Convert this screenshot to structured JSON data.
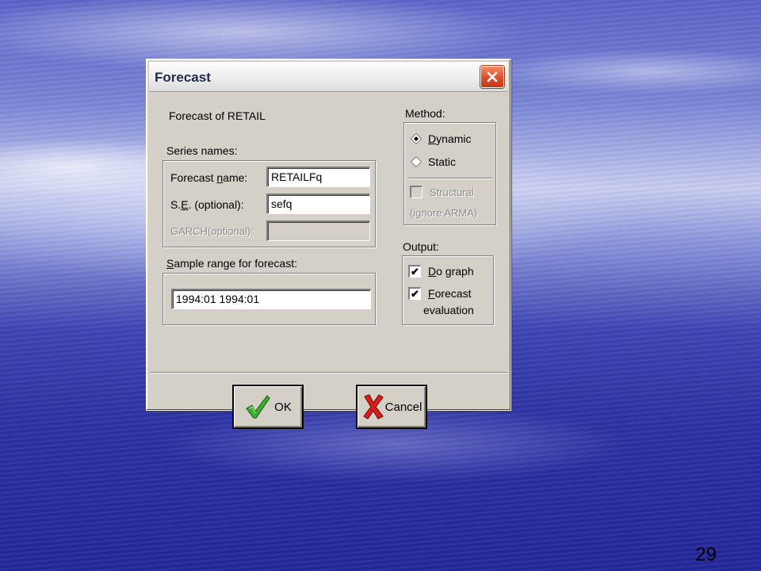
{
  "window": {
    "title": "Forecast"
  },
  "forecast_of": "Forecast of RETAIL",
  "series": {
    "label": "Series names:",
    "forecast_name": {
      "label_pre": "Forecast ",
      "label_key": "n",
      "label_post": "ame:",
      "value": "RETAILFq"
    },
    "se": {
      "label_pre": "S.",
      "label_key": "E",
      "label_post": ". (optional):",
      "value": "sefq"
    },
    "garch": {
      "label": "GARCH(optional):",
      "value": ""
    }
  },
  "sample": {
    "label_key": "S",
    "label_post": "ample range for forecast:",
    "value": "1994:01 1994:01"
  },
  "method": {
    "label": "Method:",
    "options": [
      {
        "key": "D",
        "rest": "ynamic",
        "selected": true
      },
      {
        "key": "",
        "rest": "Static",
        "selected": false
      }
    ],
    "structural": {
      "label": "Structural",
      "note": "(ignore ARMA)"
    }
  },
  "output": {
    "label": "Output:",
    "do_graph": {
      "key": "D",
      "rest": "o graph",
      "checked": true
    },
    "eval_line1": {
      "key": "F",
      "rest": "orecast"
    },
    "eval_line2": "evaluation"
  },
  "buttons": {
    "ok": "OK",
    "cancel": "Cancel"
  },
  "slide_number": "29",
  "colors": {
    "check_green": "#3ab02e",
    "cancel_red": "#d8201a",
    "close_red": "#d8502c"
  }
}
